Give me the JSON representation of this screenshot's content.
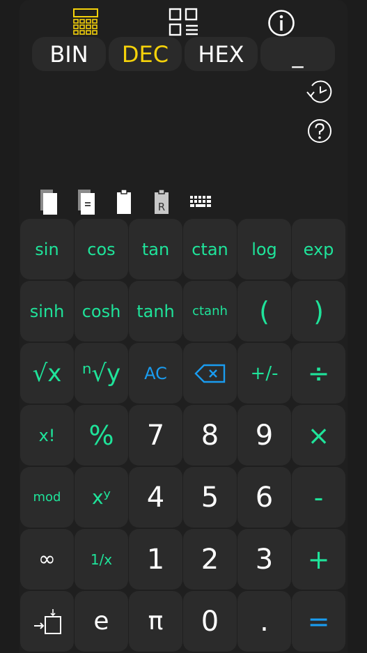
{
  "colors": {
    "accent_green": "#1fe39a",
    "accent_yellow": "#f5d20a",
    "accent_blue": "#1a9cf0",
    "background": "#1f1f1f",
    "key": "#2b2b2b"
  },
  "toolbar": {
    "icons": [
      "calculator-icon",
      "grid-menu-icon",
      "info-icon"
    ]
  },
  "modes": [
    {
      "label": "BIN",
      "active": false
    },
    {
      "label": "DEC",
      "active": true
    },
    {
      "label": "HEX",
      "active": false
    },
    {
      "label": "_",
      "active": false
    }
  ],
  "side_icons": [
    "history-icon",
    "help-icon"
  ],
  "clipboard": {
    "icons": [
      "copy-icon",
      "copy-result-icon",
      "paste-icon",
      "paste-replace-icon",
      "keyboard-icon"
    ],
    "paste_replace_letter": "R",
    "copy_result_symbol": "="
  },
  "keypad": {
    "rows": [
      [
        "sin",
        "cos",
        "tan",
        "ctan",
        "log",
        "exp"
      ],
      [
        "sinh",
        "cosh",
        "tanh",
        "ctanh",
        "(",
        ")"
      ],
      [
        "√x",
        "ⁿ√y",
        "AC",
        "⌫",
        "+/-",
        "÷"
      ],
      [
        "x!",
        "%",
        "7",
        "8",
        "9",
        "×"
      ],
      [
        "mod",
        "xʸ",
        "4",
        "5",
        "6",
        "-"
      ],
      [
        "∞",
        "1/x",
        "1",
        "2",
        "3",
        "+"
      ],
      [
        "→□",
        "e",
        "π",
        "0",
        ".",
        "="
      ]
    ]
  }
}
